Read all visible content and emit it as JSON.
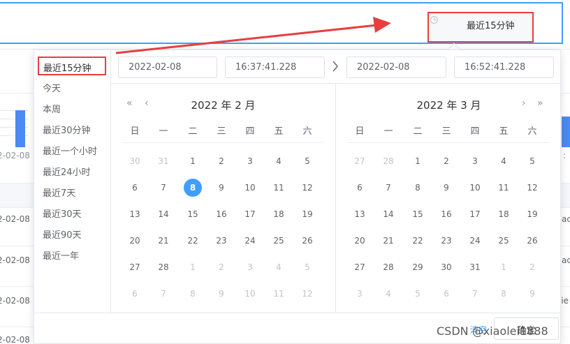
{
  "header": {
    "time_range_label": "最近15分钟"
  },
  "background": {
    "chart_tick_left": "2-02-08",
    "chart_tick_right": ":",
    "table_rows": [
      {
        "left": "2-02-08",
        "right": "ac"
      },
      {
        "left": "2-02-08",
        "right": "ac"
      },
      {
        "left": "2-02-08",
        "right": "lie"
      },
      {
        "left": "2-02-08",
        "right": ""
      }
    ]
  },
  "picker": {
    "shortcuts": [
      "最近15分钟",
      "今天",
      "本周",
      "最近30分钟",
      "最近一个小时",
      "最近24小时",
      "最近7天",
      "最近30天",
      "最近90天",
      "最近一年"
    ],
    "start_date": "2022-02-08",
    "start_time": "16:37:41.228",
    "end_date": "2022-02-08",
    "end_time": "16:52:41.228",
    "left_title": "2022 年 2 月",
    "right_title": "2022 年 3 月",
    "weekdays": [
      "日",
      "一",
      "二",
      "三",
      "四",
      "五",
      "六"
    ],
    "left_days": [
      [
        "30",
        "31",
        "1",
        "2",
        "3",
        "4",
        "5"
      ],
      [
        "6",
        "7",
        "8",
        "9",
        "10",
        "11",
        "12"
      ],
      [
        "13",
        "14",
        "15",
        "16",
        "17",
        "18",
        "19"
      ],
      [
        "20",
        "21",
        "22",
        "23",
        "24",
        "25",
        "26"
      ],
      [
        "27",
        "28",
        "1",
        "2",
        "3",
        "4",
        "5"
      ],
      [
        "6",
        "7",
        "8",
        "9",
        "10",
        "11",
        "12"
      ]
    ],
    "right_days": [
      [
        "27",
        "28",
        "1",
        "2",
        "3",
        "4",
        "5"
      ],
      [
        "6",
        "7",
        "8",
        "9",
        "10",
        "11",
        "12"
      ],
      [
        "13",
        "14",
        "15",
        "16",
        "17",
        "18",
        "19"
      ],
      [
        "20",
        "21",
        "22",
        "23",
        "24",
        "25",
        "26"
      ],
      [
        "27",
        "28",
        "29",
        "30",
        "31",
        "1",
        "2"
      ],
      [
        "3",
        "4",
        "5",
        "6",
        "7",
        "8",
        "9"
      ]
    ],
    "selected_day": "8",
    "clear_label": "清空",
    "confirm_label": "确定"
  },
  "watermark": "CSDN @xiaolei1888",
  "colors": {
    "accent": "#409eff",
    "highlight_border": "#e83e3e",
    "arrow": "#e83e3e",
    "bar": "#4a8af4"
  }
}
